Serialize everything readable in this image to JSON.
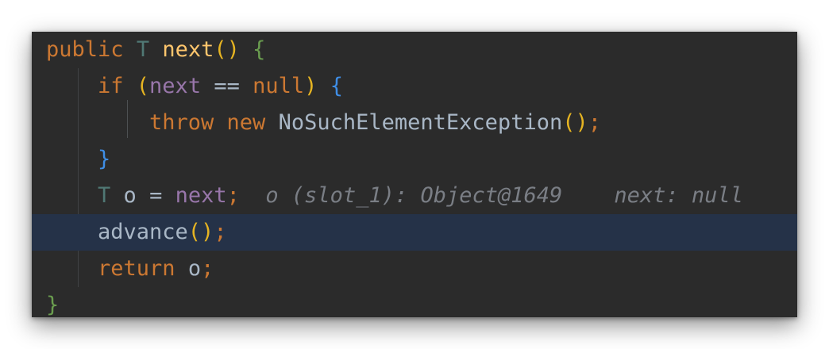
{
  "code": {
    "line1": {
      "kw_public": "public",
      "type_T": "T",
      "fn_name": "next",
      "parens": "()",
      "brace_open": "{"
    },
    "line2": {
      "kw_if": "if",
      "paren_open": "(",
      "var_next": "next",
      "op_eq": "==",
      "kw_null": "null",
      "paren_close": ")",
      "brace_open": "{"
    },
    "line3": {
      "kw_throw": "throw",
      "kw_new": "new",
      "class_name": "NoSuchElementException",
      "parens": "()",
      "semi": ";"
    },
    "line4": {
      "brace_close": "}"
    },
    "line5": {
      "type_T": "T",
      "var_o": "o",
      "op_assign": "=",
      "var_next": "next",
      "semi": ";",
      "hint_o": "o (slot_1): Object@1649",
      "hint_next": "next: null"
    },
    "line6": {
      "fn_advance": "advance",
      "parens": "()",
      "semi": ";"
    },
    "line7": {
      "kw_return": "return",
      "var_o": "o",
      "semi": ";"
    },
    "line8": {
      "brace_close": "}"
    }
  },
  "colors": {
    "editor_background": "#2b2b2b",
    "current_line_background": "#253248",
    "keyword": "#cc7832",
    "function": "#ffc66d",
    "field": "#9876aa",
    "type_param": "#507874",
    "outer_brace": "#6a9d4f",
    "inner_brace": "#3f8ee6",
    "paren": "#e6b422",
    "inline_hint": "#7a7e85"
  }
}
